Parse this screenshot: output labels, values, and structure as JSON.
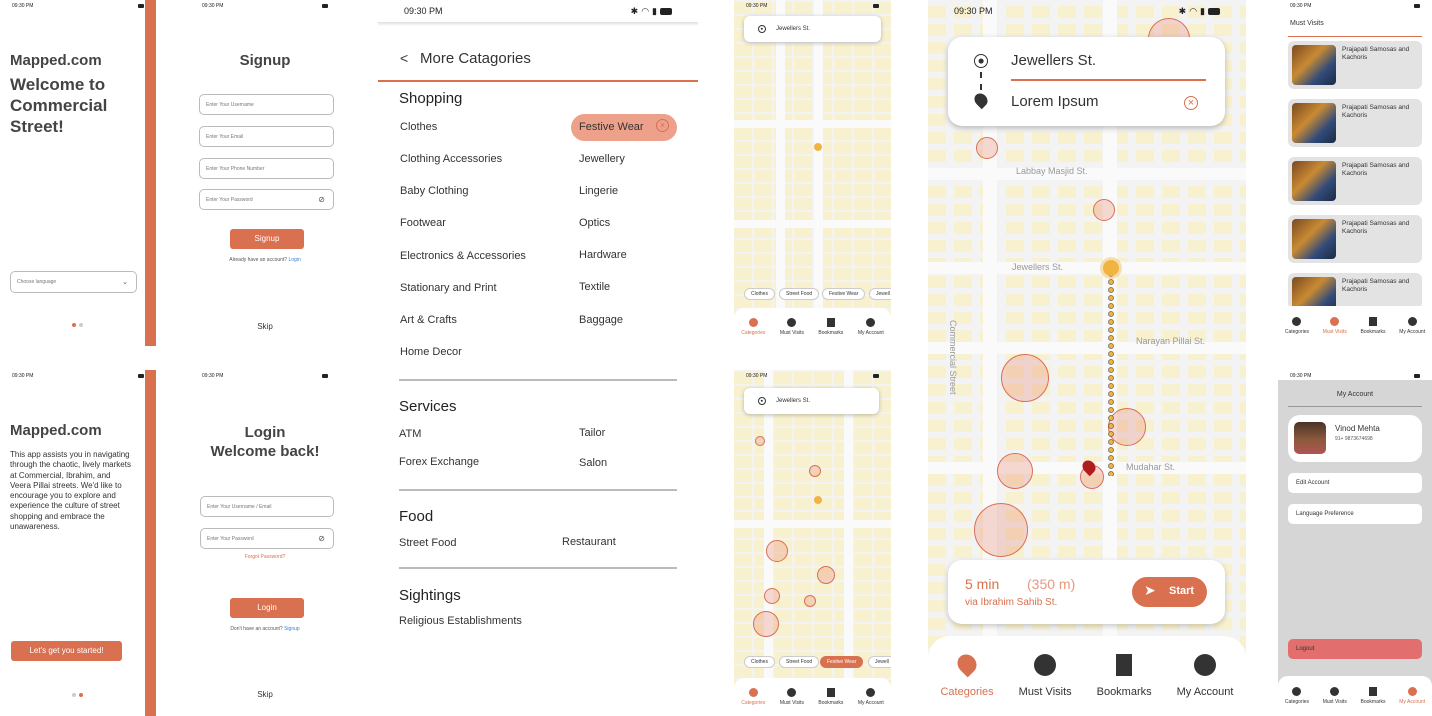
{
  "status_time": "09:30 PM",
  "welcome": {
    "brand": "Mapped.com",
    "headline": "Welcome to Commercial Street!",
    "language_select": "Choose language"
  },
  "signup": {
    "title": "Signup",
    "fields": [
      "Enter Your Username",
      "Enter Your Email",
      "Enter Your Phone Number",
      "Enter Your Password"
    ],
    "button": "Signup",
    "prompt": "Already have an account?",
    "link": "Login",
    "skip": "Skip"
  },
  "intro": {
    "brand": "Mapped.com",
    "body": "This app assists you in navigating through the chaotic, lively markets at Commercial, Ibrahim, and Veera Pillai streets. We'd like to encourage you to explore and experience the culture of street shopping and embrace the unawareness.",
    "cta": "Let's get you started!"
  },
  "login": {
    "title_line1": "Login",
    "title_line2": "Welcome back!",
    "fields": [
      "Enter Your Username / Email",
      "Enter Your Password"
    ],
    "forgot": "Forgot Password?",
    "button": "Login",
    "prompt": "Don't have an account?",
    "link": "Signup",
    "skip": "Skip"
  },
  "categories": {
    "back": "<",
    "title": "More Catagories",
    "sections": [
      {
        "heading": "Shopping",
        "left": [
          "Clothes",
          "Clothing Accessories",
          "Baby Clothing",
          "Footwear",
          "Electronics & Accessories",
          "Stationary and Print",
          "Art & Crafts",
          "Home Decor"
        ],
        "right": [
          "Festive Wear",
          "Jewellery",
          "Lingerie",
          "Optics",
          "Hardware",
          "Textile",
          "Baggage"
        ]
      },
      {
        "heading": "Services",
        "left": [
          "ATM",
          "Forex Exchange"
        ],
        "right": [
          "Tailor",
          "Salon"
        ]
      },
      {
        "heading": "Food",
        "left": [
          "Street Food"
        ],
        "right": [
          "Restaurant"
        ]
      },
      {
        "heading": "Sightings",
        "left": [
          "Religious Establishments"
        ],
        "right": []
      }
    ],
    "selected": "Festive Wear"
  },
  "map_small": {
    "search": "Jewellers St.",
    "chips": [
      "Clothes",
      "Street Food",
      "Festive Wear",
      "Jewell"
    ]
  },
  "map_large": {
    "from": "Jewellers St.",
    "to": "Lorem Ipsum",
    "streets": [
      "Labbay Masjid St.",
      "Jewellers St.",
      "Commercial Street",
      "Narayan Pillai St.",
      "Mudahar St."
    ],
    "eta": "5 min",
    "distance": "(350 m)",
    "via": "via Ibrahim Sahib St.",
    "start": "Start"
  },
  "nav": {
    "items": [
      "Categories",
      "Must Visits",
      "Bookmarks",
      "My Account"
    ]
  },
  "must_visits": {
    "title": "Must Visits",
    "items": [
      "Prajapati Samosas and Kachoris",
      "Prajapati Samosas and Kachoris",
      "Prajapati Samosas and Kachoris",
      "Prajapati Samosas and Kachoris",
      "Prajapati Samosas and Kachoris"
    ]
  },
  "account": {
    "title": "My Account",
    "name": "Vinod Mehta",
    "phone": "91+ 9873674698",
    "options": [
      "Edit Account",
      "Language Preference"
    ],
    "logout": "Logout"
  },
  "colors": {
    "accent": "#d9704f",
    "map_block": "#f8f1cf"
  }
}
